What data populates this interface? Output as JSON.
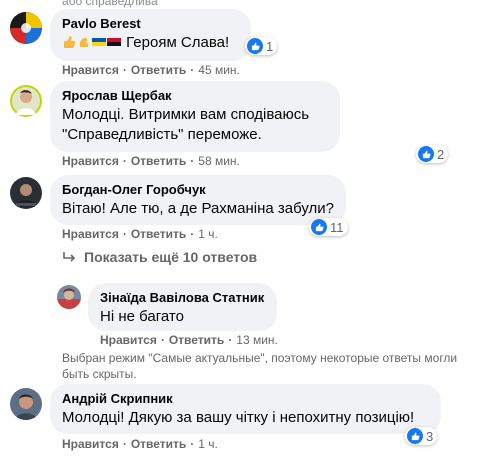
{
  "top_partial": "або справедлива",
  "comments": [
    {
      "author": "Pavlo Berest",
      "text": "Героям Слава!",
      "like": "Нравится",
      "reply": "Ответить",
      "time": "45 мин.",
      "reactions": "1"
    },
    {
      "author": "Ярослав Щербак",
      "text": "Молодці. Витримки вам сподіваюсь\n\"Справедливість\" переможе.",
      "like": "Нравится",
      "reply": "Ответить",
      "time": "58 мин.",
      "reactions": "2"
    },
    {
      "author": "Богдан-Олег Горобчук",
      "text": "Вітаю! Але тю, а де Рахманіна забули?",
      "like": "Нравится",
      "reply": "Ответить",
      "time": "1 ч.",
      "reactions": "11"
    },
    {
      "author": "Зінаїда Вавілова Статник",
      "text": "Ні не багато",
      "like": "Нравится",
      "reply": "Ответить",
      "time": "13 мин."
    },
    {
      "author": "Андрій Скрипник",
      "text": "Молодці! Дякую за вашу чітку і непохитну позицію!",
      "like": "Нравится",
      "reply": "Ответить",
      "time": "1 ч.",
      "reactions": "3"
    }
  ],
  "more_replies": "Показать ещё 10 ответов",
  "notice": "Выбран режим \"Самые актуальные\", поэтому некоторые ответы могли быть скрыты.",
  "colors": {
    "like_blue": "#1877f2",
    "bubble": "#f0f2f5",
    "meta": "#65676b"
  }
}
